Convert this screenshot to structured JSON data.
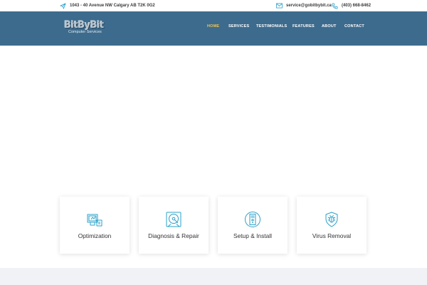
{
  "topbar": {
    "address": "1043 - 40 Avenue NW Calgary AB T2K 0G2",
    "email": "service@gobitbybit.ca",
    "phone": "(403) 668-8462"
  },
  "logo": {
    "name": "BitByBit",
    "tagline": "Computer Services"
  },
  "nav": {
    "items": [
      {
        "label": "HOME",
        "active": true
      },
      {
        "label": "SERVICES",
        "active": false
      },
      {
        "label": "TESTIMONIALS",
        "active": false
      },
      {
        "label": "FEATURES",
        "active": false
      },
      {
        "label": "ABOUT",
        "active": false
      },
      {
        "label": "CONTACT",
        "active": false
      }
    ]
  },
  "services": [
    {
      "label": "Optimization",
      "icon": "monitor-speed-icon"
    },
    {
      "label": "Diagnosis & Repair",
      "icon": "disk-repair-icon"
    },
    {
      "label": "Setup & Install",
      "icon": "pc-setup-icon"
    },
    {
      "label": "Virus Removal",
      "icon": "shield-bug-icon"
    }
  ],
  "colors": {
    "header_bg": "#3d6b8d",
    "nav_active": "#f5c242",
    "icon_stroke": "#2aa0c9",
    "footer_band": "#f1f2f6"
  }
}
